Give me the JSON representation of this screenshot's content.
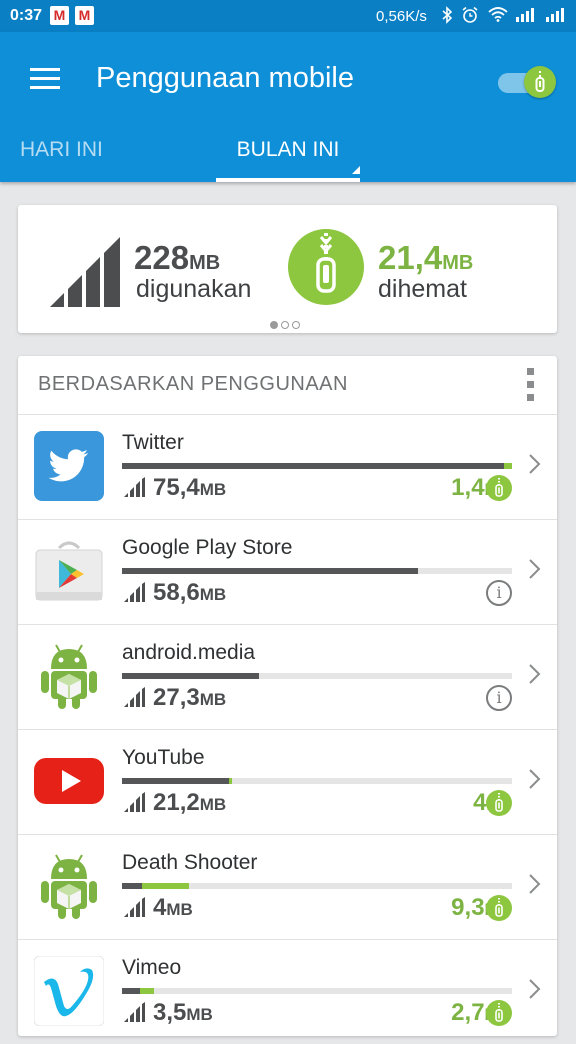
{
  "status_bar": {
    "time": "0:37",
    "notif_badges": [
      "M",
      "M"
    ],
    "network_speed": "0,56K/s",
    "icons": [
      "bluetooth-icon",
      "alarm-icon",
      "wifi-icon",
      "signal-icon",
      "signal-icon"
    ]
  },
  "app_bar": {
    "title": "Penggunaan mobile",
    "saving_toggle_on": true,
    "tabs": [
      {
        "label": "HARI INI",
        "selected": false
      },
      {
        "label": "BULAN INI",
        "selected": true
      }
    ]
  },
  "summary": {
    "used_value": "228",
    "used_unit": "MB",
    "used_label": "digunakan",
    "saved_value": "21,4",
    "saved_unit": "MB",
    "saved_label": "dihemat",
    "page_index": 0,
    "page_count": 3
  },
  "list": {
    "header": "BERDASARKAN PENGGUNAAN",
    "apps": [
      {
        "name": "Twitter",
        "icon": "twitter-icon",
        "used_value": "75,4",
        "used_unit": "MB",
        "saved_value": "1,4",
        "saved_unit": "MB",
        "used_fraction": 0.98,
        "saved_fraction": 0.02,
        "status": "saved"
      },
      {
        "name": "Google Play Store",
        "icon": "play-store-icon",
        "used_value": "58,6",
        "used_unit": "MB",
        "saved_value": "",
        "saved_unit": "",
        "used_fraction": 0.76,
        "saved_fraction": 0,
        "status": "info"
      },
      {
        "name": "android.media",
        "icon": "android-icon",
        "used_value": "27,3",
        "used_unit": "MB",
        "saved_value": "",
        "saved_unit": "",
        "used_fraction": 0.35,
        "saved_fraction": 0,
        "status": "info"
      },
      {
        "name": "YouTube",
        "icon": "youtube-icon",
        "used_value": "21,2",
        "used_unit": "MB",
        "saved_value": "4",
        "saved_unit": "KB",
        "used_fraction": 0.275,
        "saved_fraction": 0.002,
        "status": "saved"
      },
      {
        "name": "Death Shooter",
        "icon": "android-icon",
        "used_value": "4",
        "used_unit": "MB",
        "saved_value": "9,3",
        "saved_unit": "MB",
        "used_fraction": 0.05,
        "saved_fraction": 0.12,
        "status": "saved"
      },
      {
        "name": "Vimeo",
        "icon": "vimeo-icon",
        "used_value": "3,5",
        "used_unit": "MB",
        "saved_value": "2,7",
        "saved_unit": "MB",
        "used_fraction": 0.045,
        "saved_fraction": 0.035,
        "status": "saved"
      }
    ]
  },
  "colors": {
    "app_bar": "#0e8fd8",
    "status_bar": "#0a7fc4",
    "accent_green": "#8dc63f",
    "saved_text": "#7cb342",
    "used_bar": "#545658",
    "background": "#e6e7e8"
  }
}
